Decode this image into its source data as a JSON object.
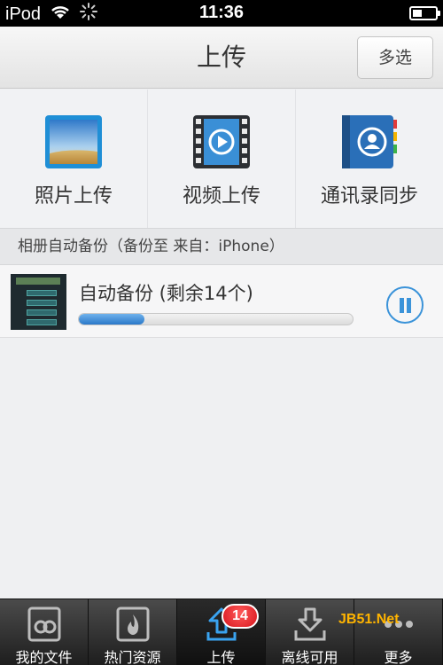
{
  "status_bar": {
    "carrier": "iPod",
    "time": "11:36"
  },
  "nav": {
    "title": "上传",
    "multi_select_label": "多选"
  },
  "upload_options": [
    {
      "label": "照片上传",
      "icon": "photo-icon"
    },
    {
      "label": "视频上传",
      "icon": "video-icon"
    },
    {
      "label": "通讯录同步",
      "icon": "contacts-sync-icon"
    }
  ],
  "section": {
    "header": "相册自动备份（备份至 来自：iPhone）"
  },
  "backup": {
    "title": "自动备份 (剩余14个)",
    "progress": 0.24
  },
  "tab_bar": {
    "tabs": [
      {
        "label": "我的文件",
        "icon": "my-files-icon"
      },
      {
        "label": "热门资源",
        "icon": "hot-resources-icon"
      },
      {
        "label": "上传",
        "icon": "upload-icon",
        "active": true
      },
      {
        "label": "离线可用",
        "icon": "offline-icon"
      },
      {
        "label": "更多",
        "icon": "more-icon"
      }
    ],
    "upload_badge": "14"
  },
  "watermark": "JB51.Net",
  "colors": {
    "accent": "#3b93d9",
    "badge": "#d7161d",
    "tab_bg": "#2b2b2b"
  }
}
